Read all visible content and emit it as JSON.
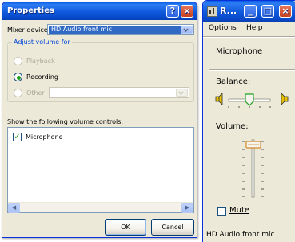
{
  "left_dialog": {
    "title": "Properties",
    "help_glyph": "?",
    "close_glyph": "×",
    "mixer_device_label": "Mixer device:",
    "mixer_device_value": "HD Audio front mic",
    "adjust_group_title": "Adjust volume for",
    "radios": [
      {
        "label": "Playback",
        "checked": false,
        "enabled": false
      },
      {
        "label": "Recording",
        "checked": true,
        "enabled": true
      },
      {
        "label": "Other",
        "checked": false,
        "enabled": false
      }
    ],
    "show_controls_label": "Show the following volume controls:",
    "controls": [
      {
        "label": "Microphone",
        "checked": true
      }
    ],
    "ok_label": "OK",
    "cancel_label": "Cancel"
  },
  "right_window": {
    "title": "R...",
    "minimize_glyph": "_",
    "maximize_glyph": "□",
    "close_glyph": "×",
    "menu": [
      "Options",
      "Help"
    ],
    "channel_name": "Microphone",
    "balance_label": "Balance:",
    "volume_label": "Volume:",
    "volume_level": 0.92,
    "balance_position": 0.5,
    "mute_label": "Mute",
    "mute_checked": false,
    "status_text": "HD Audio front mic"
  },
  "colors": {
    "title_bar_blue": "#0a5ee8",
    "close_red": "#c4401f",
    "dialog_bg": "#ece9d8",
    "selection_blue": "#316ac5",
    "check_green": "#21a121",
    "group_title_blue": "#0046d5"
  },
  "icons": {
    "window_icon": "speaker-grid-icon",
    "balance_left": "speaker-left-icon",
    "balance_right": "speaker-right-icon"
  }
}
